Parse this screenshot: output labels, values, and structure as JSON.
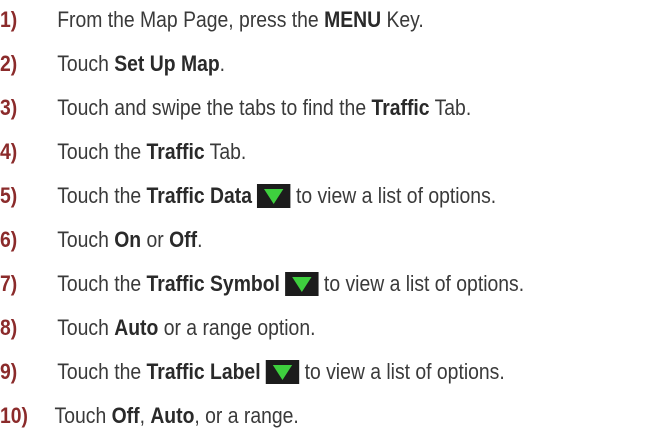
{
  "steps": [
    {
      "number": "1)",
      "segments": [
        {
          "text": "From the Map Page, press the "
        },
        {
          "text": "MENU",
          "bold": true
        },
        {
          "text": " Key."
        }
      ]
    },
    {
      "number": "2)",
      "segments": [
        {
          "text": "Touch "
        },
        {
          "text": "Set Up Map",
          "bold": true
        },
        {
          "text": "."
        }
      ]
    },
    {
      "number": "3)",
      "segments": [
        {
          "text": "Touch and swipe the tabs to find the "
        },
        {
          "text": "Traffic",
          "bold": true
        },
        {
          "text": " Tab."
        }
      ]
    },
    {
      "number": "4)",
      "segments": [
        {
          "text": "Touch the "
        },
        {
          "text": "Traffic",
          "bold": true
        },
        {
          "text": " Tab."
        }
      ]
    },
    {
      "number": "5)",
      "segments": [
        {
          "text": "Touch the "
        },
        {
          "text": "Traffic Data",
          "bold": true
        },
        {
          "icon": "dropdown-arrow-icon"
        },
        {
          "text": "to view a list of options."
        }
      ]
    },
    {
      "number": "6)",
      "segments": [
        {
          "text": "Touch "
        },
        {
          "text": "On",
          "bold": true
        },
        {
          "text": " or "
        },
        {
          "text": "Off",
          "bold": true
        },
        {
          "text": "."
        }
      ]
    },
    {
      "number": "7)",
      "segments": [
        {
          "text": "Touch the "
        },
        {
          "text": "Traffic Symbol",
          "bold": true
        },
        {
          "icon": "dropdown-arrow-icon"
        },
        {
          "text": "to view a list of options."
        }
      ]
    },
    {
      "number": "8)",
      "segments": [
        {
          "text": "Touch "
        },
        {
          "text": "Auto",
          "bold": true
        },
        {
          "text": " or a range option."
        }
      ]
    },
    {
      "number": "9)",
      "segments": [
        {
          "text": "Touch the "
        },
        {
          "text": "Traffic Label",
          "bold": true
        },
        {
          "icon": "dropdown-arrow-icon"
        },
        {
          "text": "to view a list of options."
        }
      ]
    },
    {
      "number": "10)",
      "segments": [
        {
          "text": "Touch "
        },
        {
          "text": "Off",
          "bold": true
        },
        {
          "text": ", "
        },
        {
          "text": "Auto",
          "bold": true
        },
        {
          "text": ", or a range."
        }
      ]
    }
  ],
  "colors": {
    "step_number": "#8b2b2b",
    "body_text": "#3a3a3a",
    "icon_background": "#1c1c1c",
    "icon_arrow": "#3ecf3e"
  }
}
